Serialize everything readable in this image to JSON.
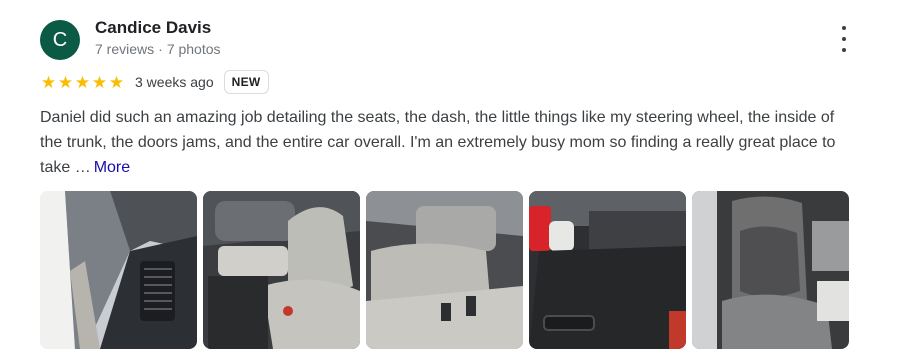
{
  "reviewer": {
    "initial": "C",
    "name": "Candice Davis",
    "reviews": "7 reviews",
    "separator": "·",
    "photos": "7 photos"
  },
  "rating": {
    "stars": 5,
    "star_glyph": "★",
    "time": "3 weeks ago",
    "badge": "NEW"
  },
  "review": {
    "text": "Daniel did such an amazing job detailing the seats, the dash, the little things like my steering wheel, the inside of the trunk, the doors jams, and the entire car overall. I'm an extremely busy mom so finding a really great place to take …",
    "more_label": "More"
  },
  "colors": {
    "avatar_bg": "#0b5a45",
    "star": "#fbbc04",
    "more_link": "#1a0dab"
  }
}
